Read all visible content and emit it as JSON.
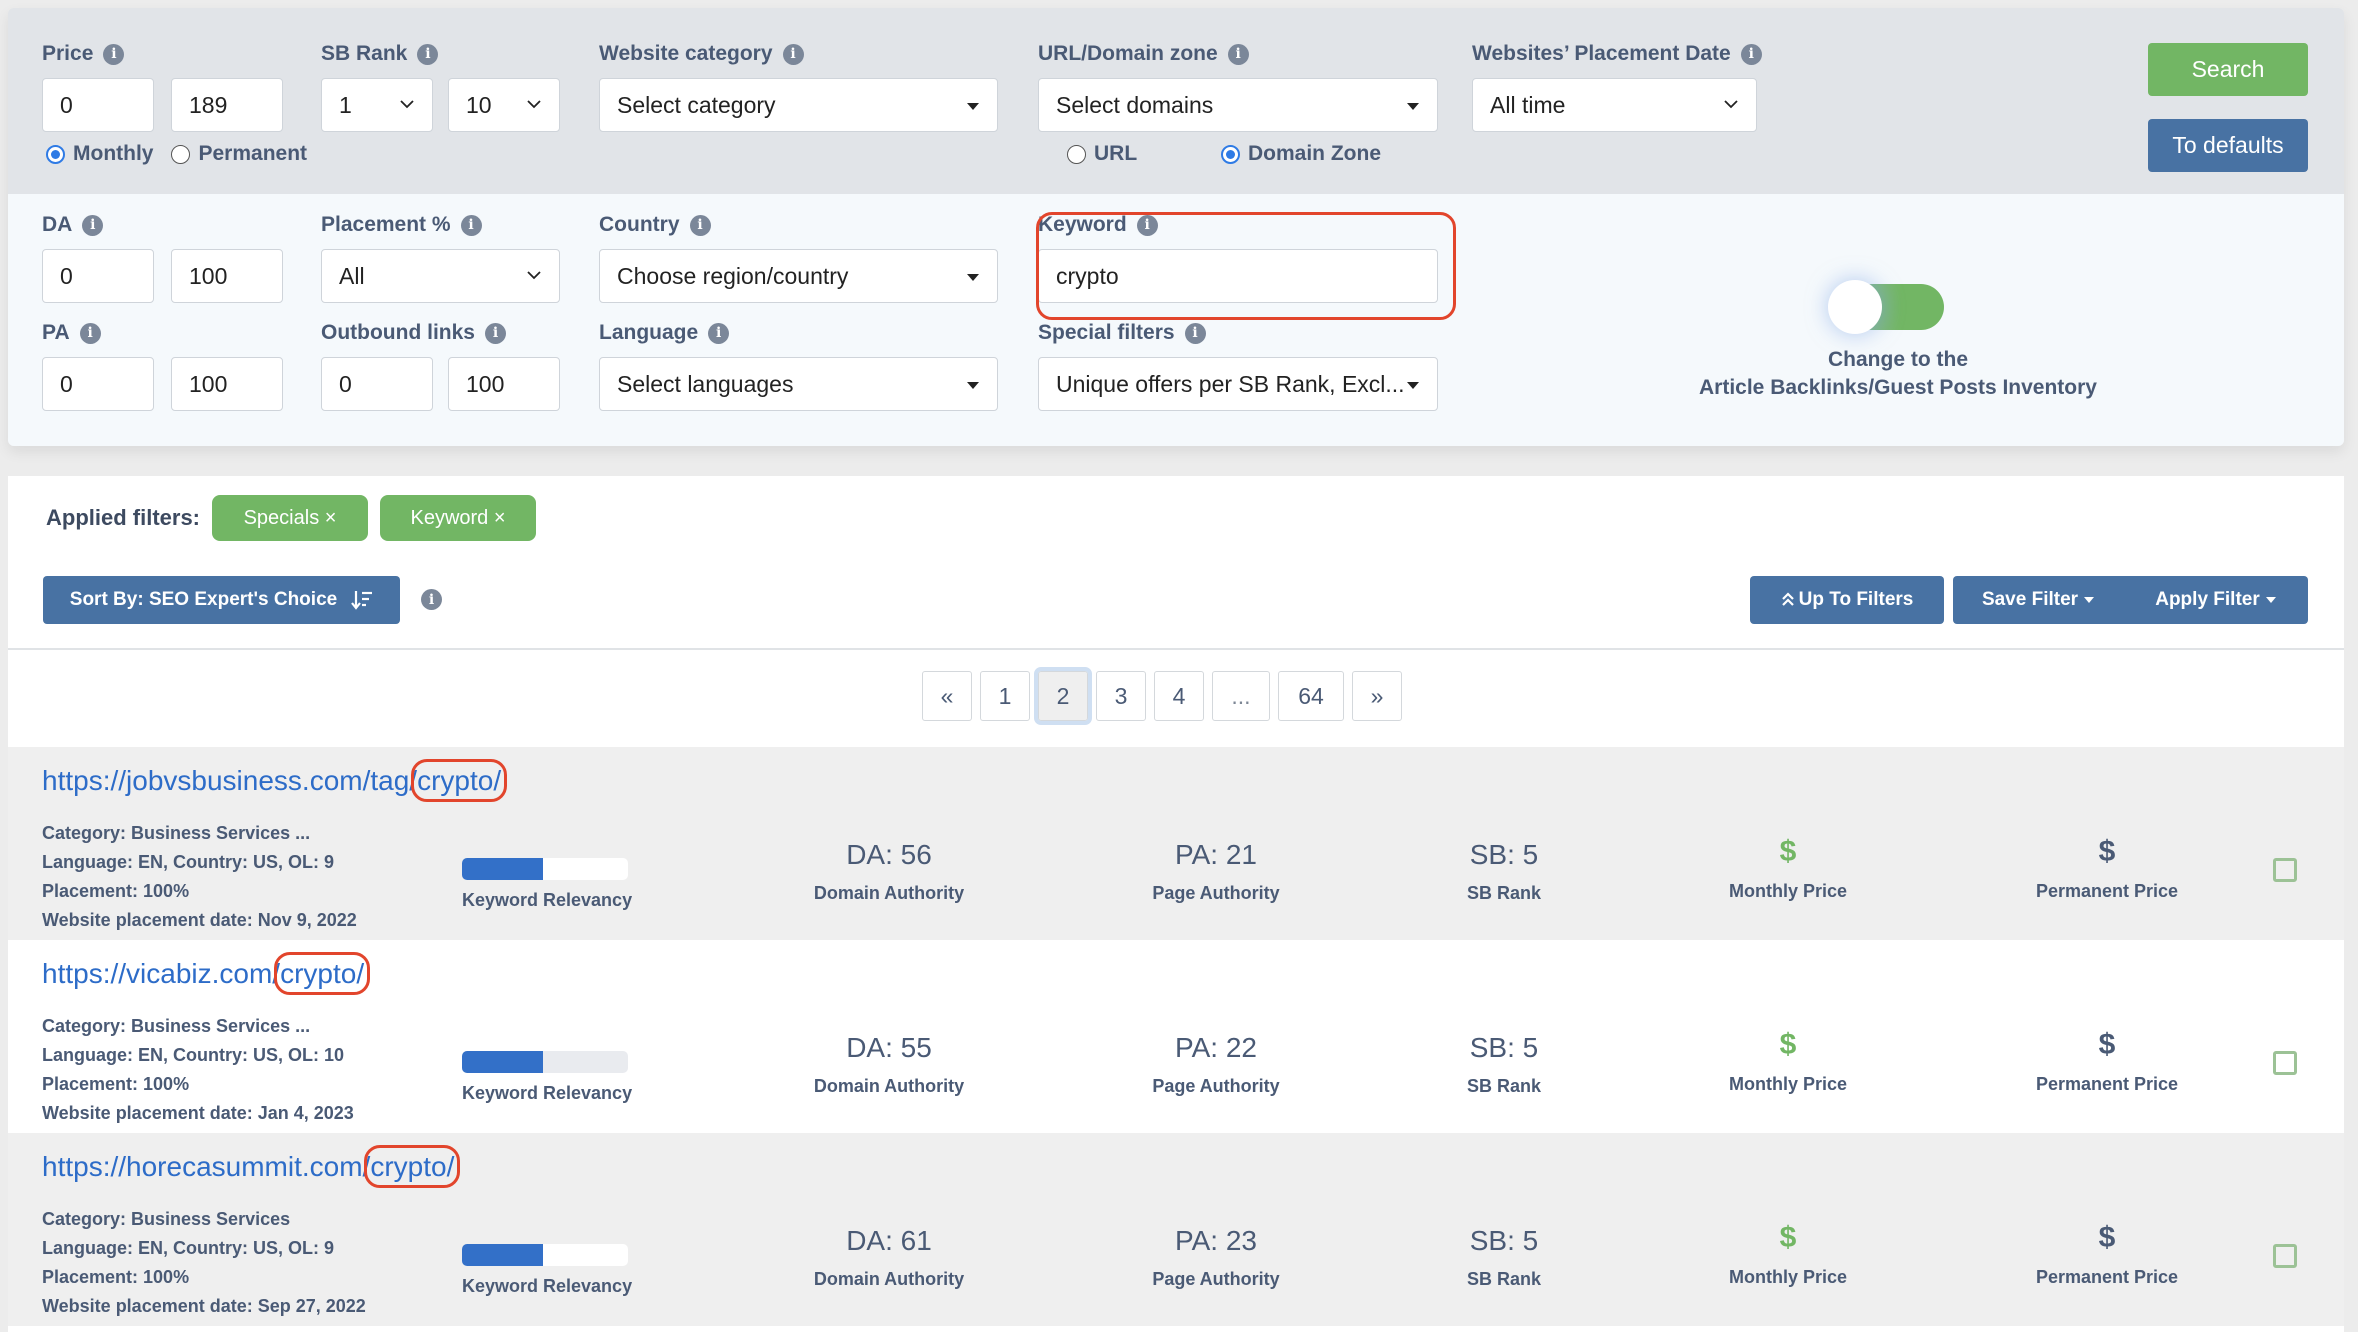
{
  "filters": {
    "price": {
      "label": "Price",
      "min": "0",
      "max": "189",
      "radio_monthly": "Monthly",
      "radio_permanent": "Permanent",
      "selected": "monthly"
    },
    "sb_rank": {
      "label": "SB Rank",
      "min": "1",
      "max": "10"
    },
    "website_category": {
      "label": "Website category",
      "value": "Select category"
    },
    "url_domain_zone": {
      "label": "URL/Domain zone",
      "value": "Select domains",
      "radio_url": "URL",
      "radio_domain_zone": "Domain Zone",
      "selected": "domain_zone"
    },
    "placement_date": {
      "label": "Websites’ Placement Date",
      "value": "All time"
    },
    "da": {
      "label": "DA",
      "min": "0",
      "max": "100"
    },
    "pa": {
      "label": "PA",
      "min": "0",
      "max": "100"
    },
    "placement_pct": {
      "label": "Placement %",
      "value": "All"
    },
    "outbound_links": {
      "label": "Outbound links",
      "min": "0",
      "max": "100"
    },
    "country": {
      "label": "Country",
      "value": "Choose region/country"
    },
    "language": {
      "label": "Language",
      "value": "Select languages"
    },
    "keyword": {
      "label": "Keyword",
      "value": "crypto"
    },
    "special_filters": {
      "label": "Special filters",
      "value": "Unique offers per SB Rank, Excl..."
    },
    "search_button": "Search",
    "defaults_button": "To defaults",
    "toggle": {
      "on": true,
      "caption_line1": "Change to the",
      "caption_line2": "Article Backlinks/Guest Posts Inventory"
    }
  },
  "applied": {
    "label": "Applied filters:",
    "chips": [
      "Specials ×",
      "Keyword ×"
    ]
  },
  "toolbar": {
    "sort_label": "Sort By: SEO Expert's Choice",
    "up_to_filters": "Up To Filters",
    "save_filter": "Save Filter",
    "apply_filter": "Apply Filter"
  },
  "pagination": {
    "prev": "«",
    "pages": [
      "1",
      "2",
      "3",
      "4",
      "...",
      "64"
    ],
    "current": "2",
    "next": "»"
  },
  "result_labels": {
    "relevancy": "Keyword Relevancy",
    "da": "Domain Authority",
    "pa": "Page Authority",
    "sb": "SB Rank",
    "monthly": "Monthly Price",
    "permanent": "Permanent Price",
    "currency_symbol": "$"
  },
  "results": [
    {
      "url_prefix": "https://jobvsbusiness.com/tag/",
      "url_keyword": "crypto/",
      "category": "Category: Business Services ...",
      "language": "Language: EN, Country: US, OL: 9",
      "placement": "Placement: 100%",
      "date": "Website placement date: Nov 9, 2022",
      "relevancy": 0.49,
      "da": "DA: 56",
      "pa": "PA: 21",
      "sb": "SB: 5"
    },
    {
      "url_prefix": "https://vicabiz.com/",
      "url_keyword": "crypto/",
      "category": "Category: Business Services ...",
      "language": "Language: EN, Country: US, OL: 10",
      "placement": "Placement: 100%",
      "date": "Website placement date: Jan 4, 2023",
      "relevancy": 0.49,
      "da": "DA: 55",
      "pa": "PA: 22",
      "sb": "SB: 5"
    },
    {
      "url_prefix": "https://horecasummit.com/",
      "url_keyword": "crypto/",
      "category": "Category: Business Services",
      "language": "Language: EN, Country: US, OL: 9",
      "placement": "Placement: 100%",
      "date": "Website placement date: Sep 27, 2022",
      "relevancy": 0.49,
      "da": "DA: 61",
      "pa": "PA: 23",
      "sb": "SB: 5"
    }
  ]
}
